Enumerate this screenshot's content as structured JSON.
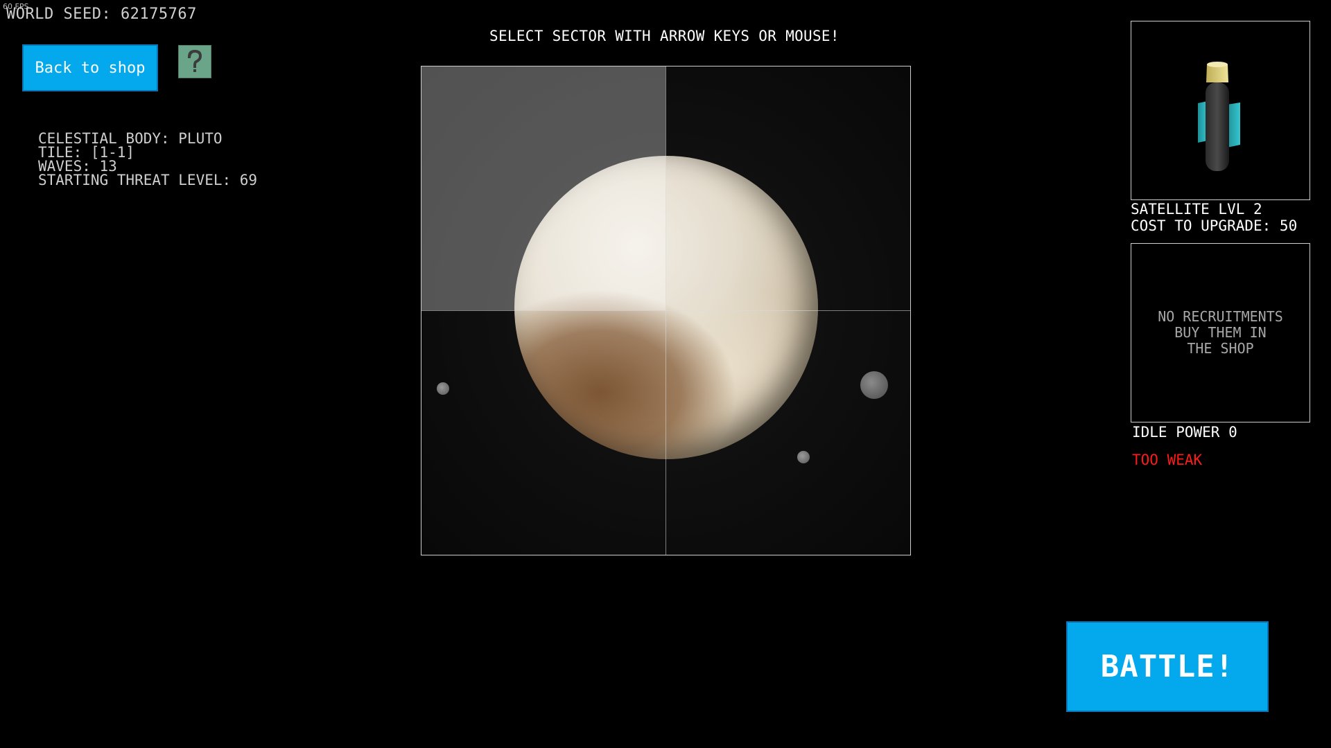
{
  "hud": {
    "fps": "60 FPS",
    "world_seed": "WORLD SEED: 62175767"
  },
  "nav": {
    "back_label": "Back to shop",
    "help_icon": "question-mark-icon"
  },
  "level_info": {
    "celestial_body": "CELESTIAL BODY: PLUTO",
    "tile": "TILE: [1-1]",
    "waves": "WAVES: 13",
    "threat": "STARTING THREAT LEVEL: 69"
  },
  "instruction": "SELECT SECTOR WITH ARROW KEYS OR MOUSE!",
  "map": {
    "selected_sector": "1-1",
    "sectors": [
      "1-1",
      "1-2",
      "2-1",
      "2-2"
    ]
  },
  "satellite": {
    "level": "SATELLITE LVL 2",
    "upgrade_cost": "COST TO UPGRADE: 50"
  },
  "recruitments": {
    "line1": "NO RECRUITMENTS",
    "line2": "BUY THEM IN",
    "line3": "THE SHOP"
  },
  "status": {
    "idle_power": "IDLE POWER 0",
    "warning": "TOO WEAK",
    "warning_color": "#ff1a1a"
  },
  "actions": {
    "battle_label": "BATTLE!"
  },
  "colors": {
    "button": "#03a9ec",
    "help_button": "#6aa58a"
  }
}
